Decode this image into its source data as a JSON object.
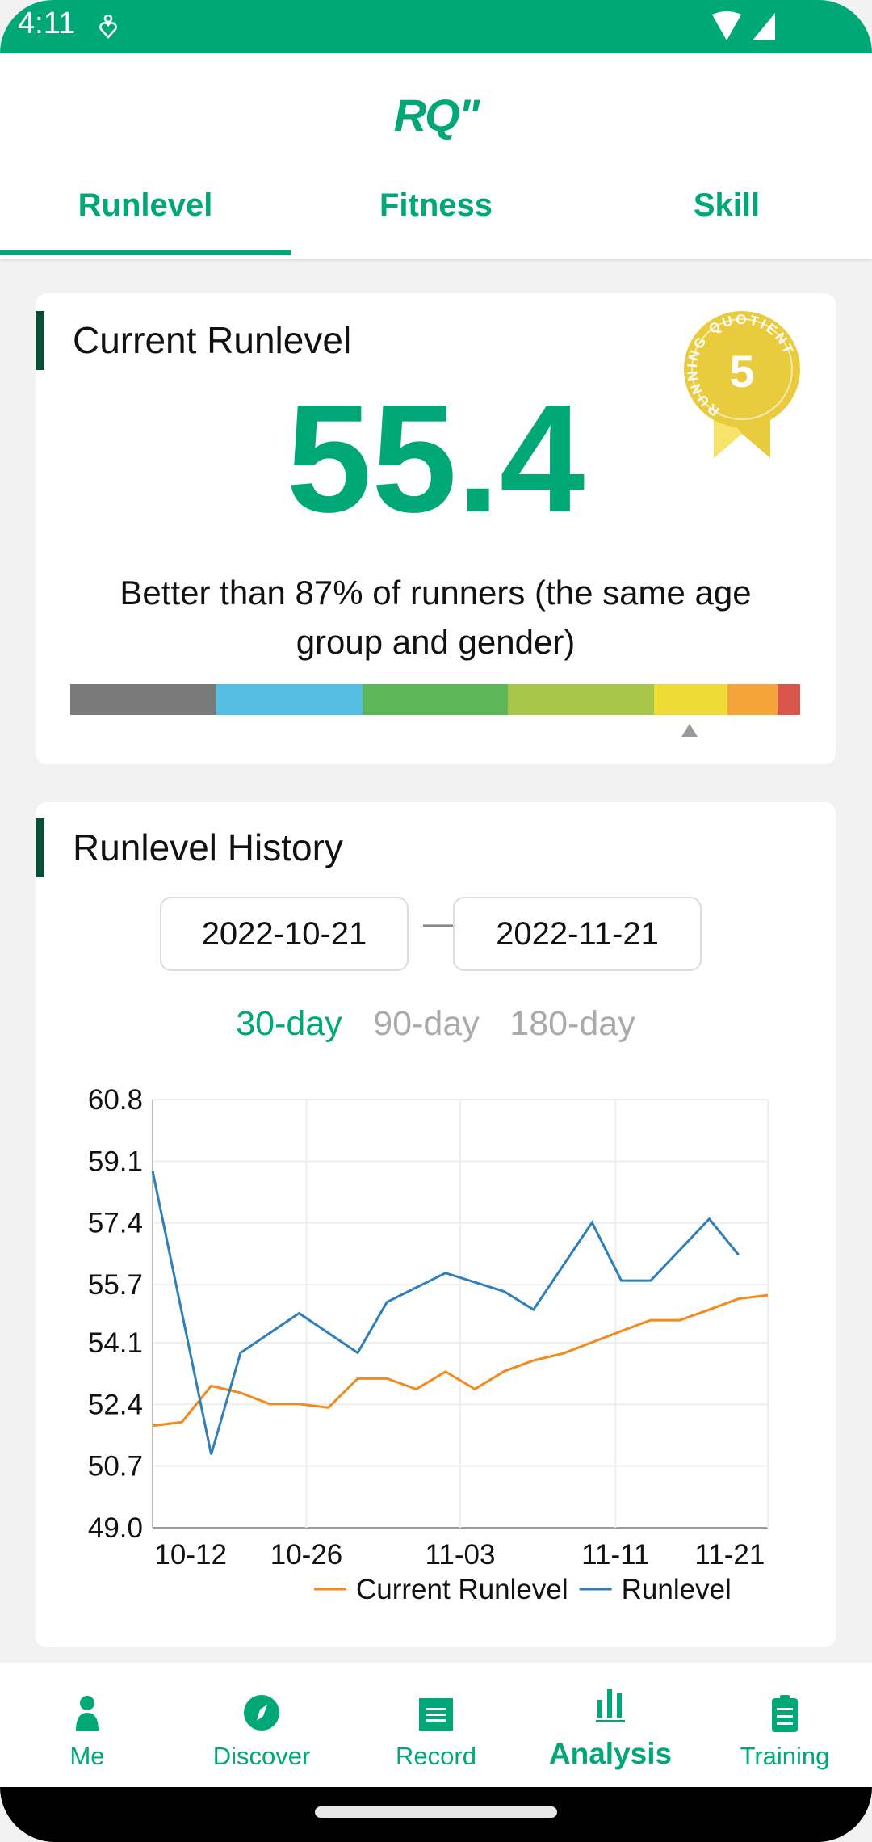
{
  "status_bar": {
    "time": "4:11"
  },
  "header": {
    "logo": "RQ\"",
    "tabs": [
      "Runlevel",
      "Fitness",
      "Skill"
    ],
    "active_tab": 0
  },
  "current": {
    "title": "Current Runlevel",
    "value": "55.4",
    "percentile_text": "Better than 87% of runners (the same age group and gender)",
    "badge": {
      "text": "RUNNING QUOTIENT",
      "number": "5"
    },
    "level_bar": {
      "segments": [
        {
          "color": "#7a7a7a",
          "fraction": 0.2
        },
        {
          "color": "#55bfe3",
          "fraction": 0.2
        },
        {
          "color": "#5db85a",
          "fraction": 0.2
        },
        {
          "color": "#a8c64a",
          "fraction": 0.2
        },
        {
          "color": "#eedc36",
          "fraction": 0.1
        },
        {
          "color": "#f3a43a",
          "fraction": 0.069
        },
        {
          "color": "#d9574a",
          "fraction": 0.031
        }
      ],
      "marker_position": 0.849
    }
  },
  "history": {
    "title": "Runlevel History",
    "start_date": "2022-10-21",
    "separator": "—",
    "end_date": "2022-11-21",
    "periods": [
      "30-day",
      "90-day",
      "180-day"
    ],
    "active_period": 0
  },
  "chart_data": {
    "type": "line",
    "ylim": [
      49.0,
      60.8
    ],
    "y_ticks": [
      "60.8",
      "59.1",
      "57.4",
      "55.7",
      "54.1",
      "52.4",
      "50.7",
      "49.0"
    ],
    "grid": true,
    "legend_placement": "bottom-right",
    "x_ticks": [
      {
        "label": "10-12",
        "at": 1.3
      },
      {
        "label": "10-26",
        "at": 5.25
      },
      {
        "label": "11-03",
        "at": 10.5
      },
      {
        "label": "11-11",
        "at": 15.8
      },
      {
        "label": "11-21",
        "at": 19.7
      }
    ],
    "x_count": 22,
    "series": [
      {
        "name": "Current Runlevel",
        "color": "#f28a1e",
        "points": [
          [
            0,
            51.81
          ],
          [
            1,
            51.91
          ],
          [
            2,
            52.91
          ],
          [
            3,
            52.72
          ],
          [
            4,
            52.41
          ],
          [
            5,
            52.41
          ],
          [
            6,
            52.31
          ],
          [
            7,
            53.11
          ],
          [
            8,
            53.11
          ],
          [
            9,
            52.82
          ],
          [
            10,
            53.3
          ],
          [
            11,
            52.82
          ],
          [
            12,
            53.31
          ],
          [
            13,
            53.61
          ],
          [
            14,
            53.8
          ],
          [
            15,
            54.11
          ],
          [
            16,
            54.42
          ],
          [
            17,
            54.72
          ],
          [
            18,
            54.72
          ],
          [
            19,
            55.01
          ],
          [
            20,
            55.31
          ],
          [
            21,
            55.41
          ]
        ]
      },
      {
        "name": "Runlevel",
        "color": "#2f7fb8",
        "points": [
          [
            0,
            58.83
          ],
          [
            2,
            51.02
          ],
          [
            3,
            53.82
          ],
          [
            5,
            54.91
          ],
          [
            7,
            53.82
          ],
          [
            8,
            55.22
          ],
          [
            10,
            56.02
          ],
          [
            12,
            55.51
          ],
          [
            13,
            55.01
          ],
          [
            15,
            57.41
          ],
          [
            16,
            55.81
          ],
          [
            17,
            55.81
          ],
          [
            19,
            57.51
          ],
          [
            20,
            56.52
          ]
        ]
      }
    ]
  },
  "nav": {
    "items": [
      {
        "label": "Me",
        "icon": "person-icon"
      },
      {
        "label": "Discover",
        "icon": "compass-icon"
      },
      {
        "label": "Record",
        "icon": "calendar-icon"
      },
      {
        "label": "Analysis",
        "icon": "bar-chart-icon"
      },
      {
        "label": "Training",
        "icon": "clipboard-icon"
      }
    ],
    "active": 3
  },
  "colors": {
    "brand": "#00a878"
  }
}
